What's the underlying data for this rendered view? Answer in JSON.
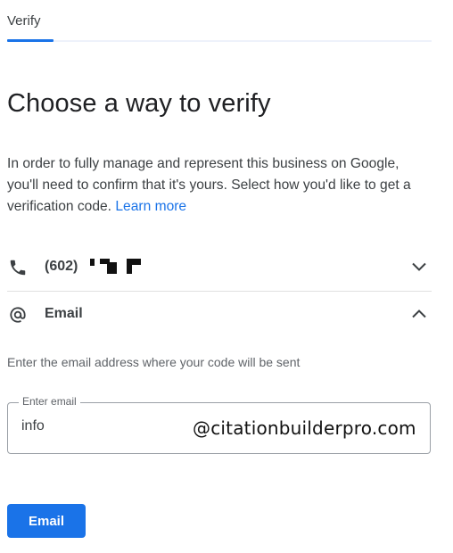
{
  "tab": {
    "label": "Verify"
  },
  "title": "Choose a way to verify",
  "description": {
    "text": "In order to fully manage and represent this business on Google, you'll need to confirm that it's yours. Select how you'd like to get a verification code.",
    "link": "Learn more"
  },
  "options": [
    {
      "icon": "phone-icon",
      "label": "(602)",
      "state": "collapsed"
    },
    {
      "icon": "at-sign-icon",
      "label": "Email",
      "state": "expanded"
    }
  ],
  "email_panel": {
    "helper": "Enter the email address where your code will be sent",
    "field_label": "Enter email",
    "value": "info",
    "suffix": "@citationbuilderpro.com"
  },
  "submit": {
    "label": "Email"
  },
  "colors": {
    "accent": "#1a73e8",
    "text": "#202124",
    "muted": "#5f6368",
    "divider": "#e0e0e0"
  }
}
